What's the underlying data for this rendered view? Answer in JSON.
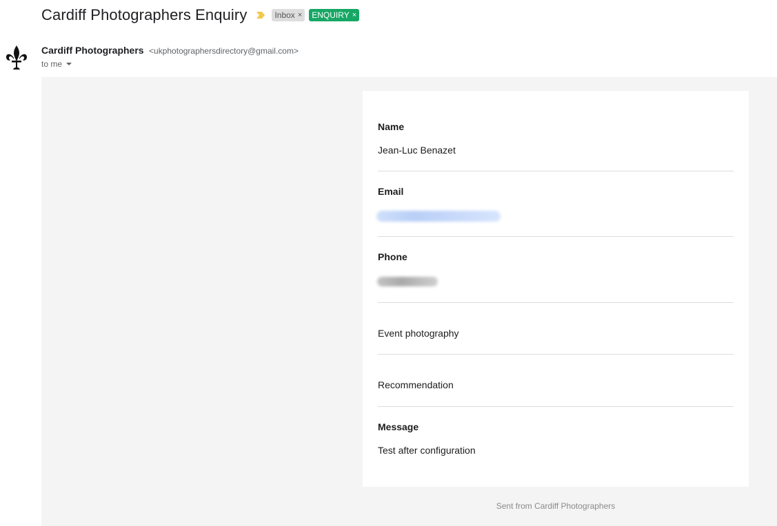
{
  "email": {
    "subject": "Cardiff Photographers Enquiry",
    "labels": [
      {
        "text": "Inbox",
        "bg": "#dddddd",
        "fg": "#555555"
      },
      {
        "text": "ENQUIRY",
        "bg": "#16a765",
        "fg": "#ffffff"
      }
    ],
    "label_remove_glyph": "×",
    "importance_color": "#f2c94c",
    "sender": {
      "name": "Cardiff Photographers",
      "address": "<ukphotographersdirectory@gmail.com>"
    },
    "recipient": "to me"
  },
  "form": {
    "name_label": "Name",
    "name_value": "Jean-Luc Benazet",
    "email_label": "Email",
    "email_value_hidden": "redacted (blurred)",
    "phone_label": "Phone",
    "phone_value_hidden": "redacted (blurred)",
    "service": "Event photography",
    "source": "Recommendation",
    "message_label": "Message",
    "message_value": "Test after configuration"
  },
  "footer": "Sent from Cardiff Photographers"
}
